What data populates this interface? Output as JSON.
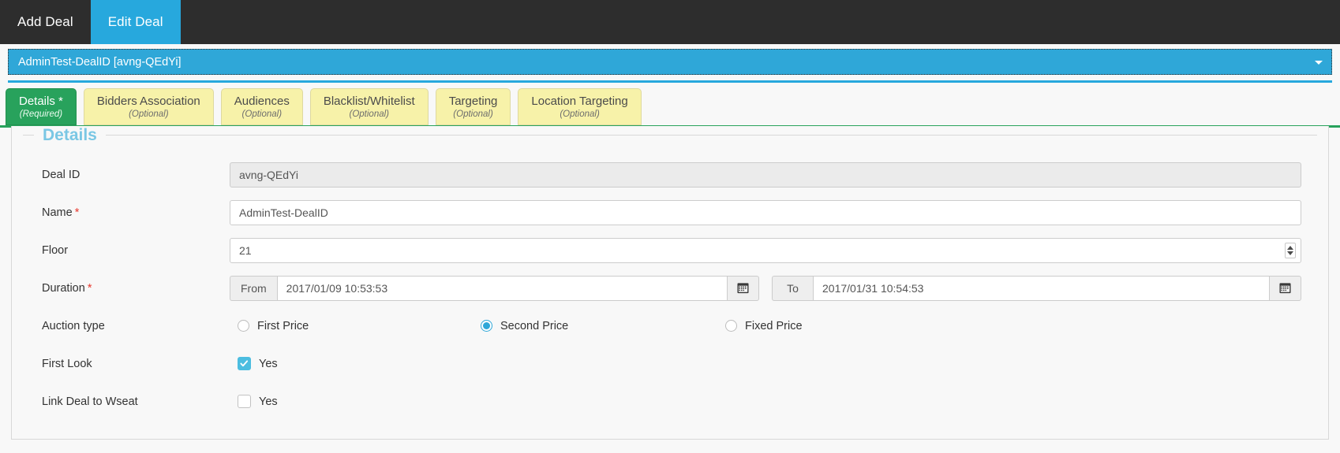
{
  "topnav": {
    "tabs": [
      {
        "label": "Add Deal",
        "active": false
      },
      {
        "label": "Edit Deal",
        "active": true
      }
    ]
  },
  "deal_selector": {
    "value": "AdminTest-DealID [avng-QEdYi]",
    "caret_icon": "chevron-down-icon"
  },
  "tabs": [
    {
      "title": "Details *",
      "sub": "(Required)",
      "active": true
    },
    {
      "title": "Bidders Association",
      "sub": "(Optional)",
      "active": false
    },
    {
      "title": "Audiences",
      "sub": "(Optional)",
      "active": false
    },
    {
      "title": "Blacklist/Whitelist",
      "sub": "(Optional)",
      "active": false
    },
    {
      "title": "Targeting",
      "sub": "(Optional)",
      "active": false
    },
    {
      "title": "Location Targeting",
      "sub": "(Optional)",
      "active": false
    }
  ],
  "panel": {
    "legend": "Details"
  },
  "fields": {
    "deal_id": {
      "label": "Deal ID",
      "value": "avng-QEdYi"
    },
    "name": {
      "label": "Name",
      "required": "*",
      "value": "AdminTest-DealID"
    },
    "floor": {
      "label": "Floor",
      "value": "21",
      "spinner_icon": "spinner-updown-icon"
    },
    "duration": {
      "label": "Duration",
      "required": "*",
      "from_addon": "From",
      "from_value": "2017/01/09 10:53:53",
      "to_addon": "To",
      "to_value": "2017/01/31 10:54:53",
      "calendar_icon": "calendar-icon"
    },
    "auction_type": {
      "label": "Auction type",
      "options": [
        {
          "label": "First Price",
          "selected": false
        },
        {
          "label": "Second Price",
          "selected": true
        },
        {
          "label": "Fixed Price",
          "selected": false
        }
      ]
    },
    "first_look": {
      "label": "First Look",
      "option_label": "Yes",
      "checked": true
    },
    "link_deal_to_wseat": {
      "label": "Link Deal to Wseat",
      "option_label": "Yes",
      "checked": false
    }
  },
  "colors": {
    "accent_blue": "#2fa7d8",
    "active_tab_green": "#28a25c",
    "tab_yellow": "#f7f2a9",
    "header_dark": "#2d2d2d",
    "required_red": "#e8392f",
    "legend_blue": "#7ac7e4"
  }
}
